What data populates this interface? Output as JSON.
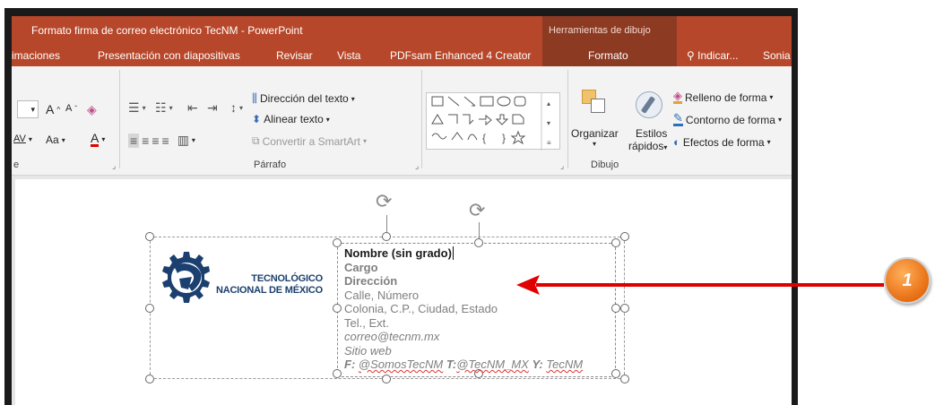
{
  "app": {
    "title": "Formato firma de correo electrónico TecNM - PowerPoint",
    "context_header": "Herramientas de dibujo"
  },
  "tabs": [
    "imaciones",
    "Presentación con diapositivas",
    "Revisar",
    "Vista",
    "PDFsam Enhanced 4 Creator",
    "Formato"
  ],
  "tell_me": "Indicar...",
  "user": "Sonia",
  "ribbon": {
    "font_grow": "A",
    "font_shrink": "A",
    "char_spacing": "AV",
    "change_case": "Aa",
    "font_color": "A",
    "text_direction": "Dirección del texto",
    "align_text": "Alinear texto",
    "convert_smartart": "Convertir a SmartArt",
    "group_paragraph": "Párrafo",
    "group_font_tail": "e",
    "organize": "Organizar",
    "quick_styles_1": "Estilos",
    "quick_styles_2": "rápidos",
    "shape_fill": "Relleno de forma",
    "shape_outline": "Contorno de forma",
    "shape_effects": "Efectos de forma",
    "group_drawing": "Dibujo"
  },
  "logo": {
    "line1": "TECNOLÓGICO",
    "line2": "NACIONAL DE MÉXICO"
  },
  "signature": {
    "name": "Nombre (sin grado)",
    "position": "Cargo",
    "department": "Dirección",
    "street": "Calle, Número",
    "city": "Colonia, C.P., Ciudad, Estado",
    "phone": "Tel., Ext.",
    "email": "correo@tecnm.mx",
    "website": "Sitio web",
    "social_f_label": "F:",
    "social_f": "@SomosTecNM",
    "social_t_label": "T:",
    "social_t": "@TecNM_MX",
    "social_y_label": "Y:",
    "social_y": "TecNM"
  },
  "callout": {
    "number": "1"
  },
  "colors": {
    "accent": "#b7472a",
    "context": "#8d3a22",
    "arrow": "#e00000",
    "logo_blue": "#1b3f6e"
  }
}
